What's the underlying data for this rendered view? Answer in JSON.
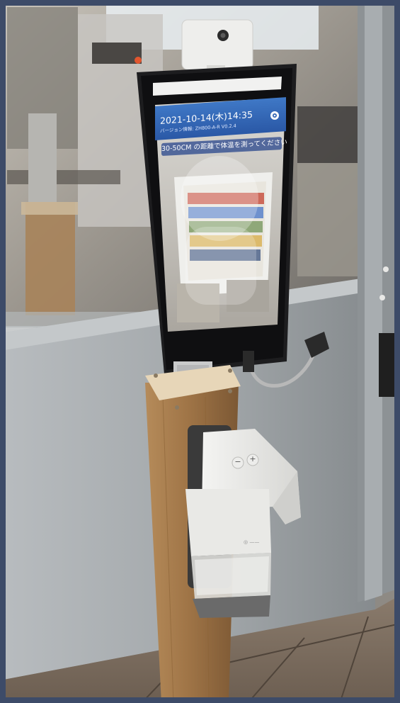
{
  "screen": {
    "datetime": "2021-10-14(木)14:35",
    "version": "バージョン情報: ZH800-A-R V0.2.4",
    "instruction": "30-50CM の距離で体温を測ってください",
    "settings_icon": "gear-icon"
  },
  "dispenser": {
    "minus_label": "−",
    "plus_label": "+"
  },
  "colors": {
    "header_blue": "#2f63b3",
    "post_wood": "#9a7347",
    "wall_gray": "#a3a8ab"
  }
}
